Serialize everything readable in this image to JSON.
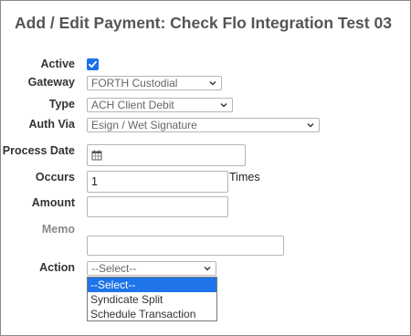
{
  "page": {
    "title": "Add / Edit Payment: Check Flo Integration Test 03"
  },
  "form": {
    "active_label": "Active",
    "gateway_label": "Gateway",
    "gateway_value": "FORTH Custodial",
    "type_label": "Type",
    "type_value": "ACH Client Debit",
    "auth_label": "Auth Via",
    "auth_value": "Esign / Wet Signature",
    "process_date_label": "Process Date",
    "process_date_value": "",
    "occurs_label": "Occurs",
    "occurs_value": "1",
    "occurs_suffix": "Times",
    "amount_label": "Amount",
    "amount_value": "",
    "memo_label": "Memo",
    "memo_value": "",
    "action_label": "Action",
    "action_value": "--Select--",
    "action_options": [
      "--Select--",
      "Syndicate Split",
      "Schedule Transaction"
    ]
  },
  "colors": {
    "accent": "#1e74e8",
    "checkbox": "#1a73e8"
  },
  "icons": {
    "active_checkbox": "checkmark-icon",
    "dropdown_arrow": "chevron-down-icon",
    "date_picker": "calendar-icon"
  }
}
